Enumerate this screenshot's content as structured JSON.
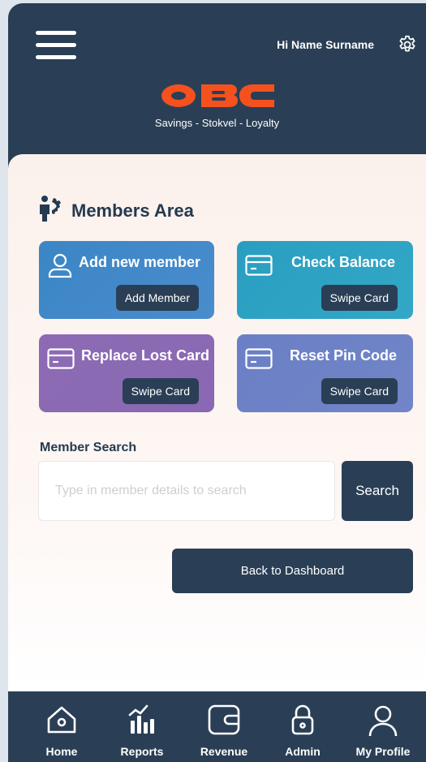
{
  "header": {
    "greeting": "Hi Name Surname",
    "logo_text": "OBC",
    "tagline": "Savings - Stokvel - Loyalty",
    "brand_color": "#f4511e"
  },
  "members": {
    "title": "Members Area",
    "tiles": [
      {
        "title": "Add new member",
        "button": "Add Member",
        "icon": "user-icon"
      },
      {
        "title": "Check Balance",
        "button": "Swipe Card",
        "icon": "card-icon"
      },
      {
        "title": "Replace Lost Card",
        "button": "Swipe Card",
        "icon": "card-icon"
      },
      {
        "title": "Reset Pin Code",
        "button": "Swipe Card",
        "icon": "card-icon"
      }
    ]
  },
  "search": {
    "label": "Member Search",
    "placeholder": "Type in member details to search",
    "value": "",
    "button": "Search"
  },
  "back_button": "Back to Dashboard",
  "nav": [
    {
      "label": "Home",
      "icon": "home-icon"
    },
    {
      "label": "Reports",
      "icon": "reports-icon"
    },
    {
      "label": "Revenue",
      "icon": "wallet-icon"
    },
    {
      "label": "Admin",
      "icon": "lock-icon"
    },
    {
      "label": "My Profile",
      "icon": "profile-icon"
    }
  ],
  "colors": {
    "navy": "#2a3f55",
    "tile_blue": "#3b86c5",
    "tile_teal": "#2a9ec0",
    "tile_purple": "#8c6bb4",
    "tile_indigo": "#6a7fc6"
  }
}
